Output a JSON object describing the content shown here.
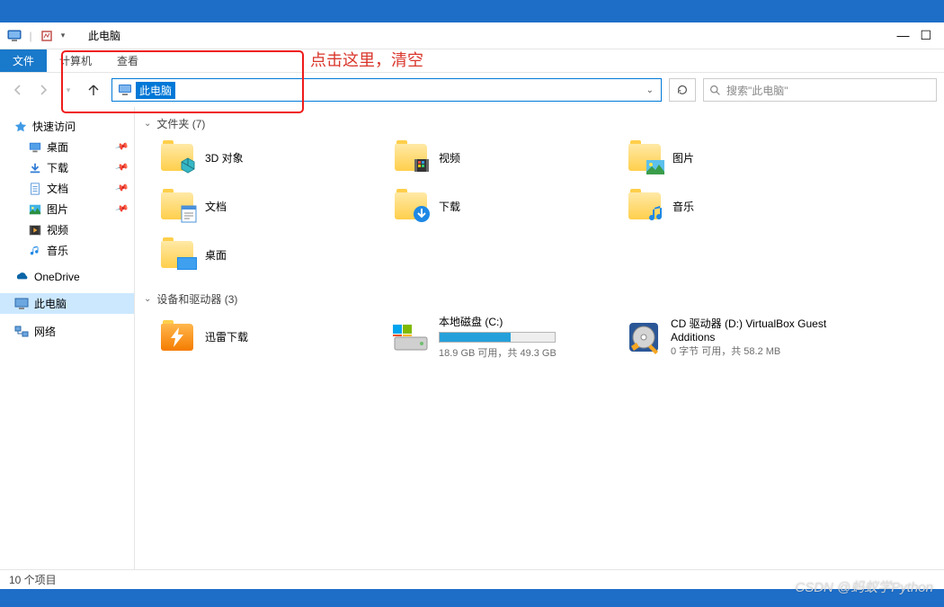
{
  "title": "此电脑",
  "ribbon": {
    "file": "文件",
    "tabs": [
      "计算机",
      "查看"
    ]
  },
  "annotation": "点击这里，清空",
  "address": {
    "text": "此电脑"
  },
  "search": {
    "placeholder": "搜索\"此电脑\""
  },
  "sidebar": {
    "quick_access": "快速访问",
    "quick_items": [
      {
        "label": "桌面",
        "icon": "desktop",
        "pinned": true
      },
      {
        "label": "下载",
        "icon": "download",
        "pinned": true
      },
      {
        "label": "文档",
        "icon": "document",
        "pinned": true
      },
      {
        "label": "图片",
        "icon": "picture",
        "pinned": true
      },
      {
        "label": "视频",
        "icon": "video",
        "pinned": false
      },
      {
        "label": "音乐",
        "icon": "music",
        "pinned": false
      }
    ],
    "onedrive": "OneDrive",
    "this_pc": "此电脑",
    "network": "网络"
  },
  "groups": {
    "folders": {
      "label": "文件夹 (7)",
      "items": [
        {
          "name": "3D 对象",
          "icon": "3d"
        },
        {
          "name": "视频",
          "icon": "video"
        },
        {
          "name": "图片",
          "icon": "picture"
        },
        {
          "name": "文档",
          "icon": "document"
        },
        {
          "name": "下载",
          "icon": "download"
        },
        {
          "name": "音乐",
          "icon": "music"
        },
        {
          "name": "桌面",
          "icon": "desktop"
        }
      ]
    },
    "drives": {
      "label": "设备和驱动器 (3)",
      "items": [
        {
          "name": "迅雷下载",
          "icon": "thunder",
          "sub": ""
        },
        {
          "name": "本地磁盘 (C:)",
          "icon": "hdd",
          "sub": "18.9 GB 可用，共 49.3 GB",
          "fill_pct": 62
        },
        {
          "name": "CD 驱动器 (D:) VirtualBox Guest Additions",
          "icon": "cd",
          "sub": "0 字节 可用，共 58.2 MB"
        }
      ]
    }
  },
  "statusbar": "10 个项目",
  "watermark": "CSDN @蚂蚁学Python"
}
